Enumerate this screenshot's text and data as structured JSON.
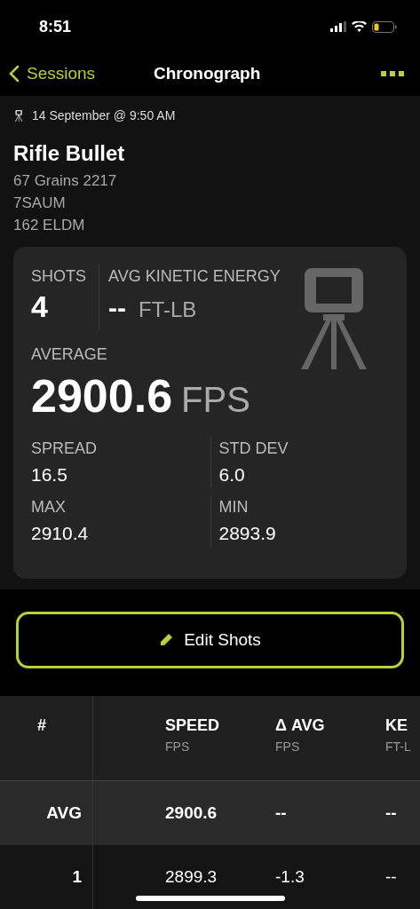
{
  "status_bar": {
    "time": "8:51"
  },
  "nav": {
    "back": "Sessions",
    "title": "Chronograph"
  },
  "session": {
    "date": "14 September @ 9:50 AM",
    "title": "Rifle Bullet",
    "details": [
      "67 Grains 2217",
      "7SAUM",
      "162 ELDM"
    ]
  },
  "summary": {
    "shots_label": "SHOTS",
    "shots": "4",
    "ke_label": "AVG KINETIC ENERGY",
    "ke_value": "--",
    "ke_unit": "FT-LB",
    "average_label": "AVERAGE",
    "average": "2900.6",
    "average_unit": "FPS",
    "stats": [
      {
        "label": "SPREAD",
        "value": "16.5"
      },
      {
        "label": "STD DEV",
        "value": "6.0"
      },
      {
        "label": "MAX",
        "value": "2910.4"
      },
      {
        "label": "MIN",
        "value": "2893.9"
      }
    ]
  },
  "edit_button": "Edit Shots",
  "table": {
    "columns": [
      {
        "label": "#"
      },
      {
        "label": "SPEED",
        "unit": "FPS"
      },
      {
        "label": "Δ AVG",
        "unit": "FPS"
      },
      {
        "label": "KE",
        "unit": "FT-L"
      }
    ],
    "rows": [
      {
        "kind": "average",
        "cells": [
          "AVG",
          "2900.6",
          "--",
          "--"
        ]
      },
      {
        "kind": "shot",
        "cells": [
          "1",
          "2899.3",
          "-1.3",
          "--"
        ]
      }
    ]
  }
}
